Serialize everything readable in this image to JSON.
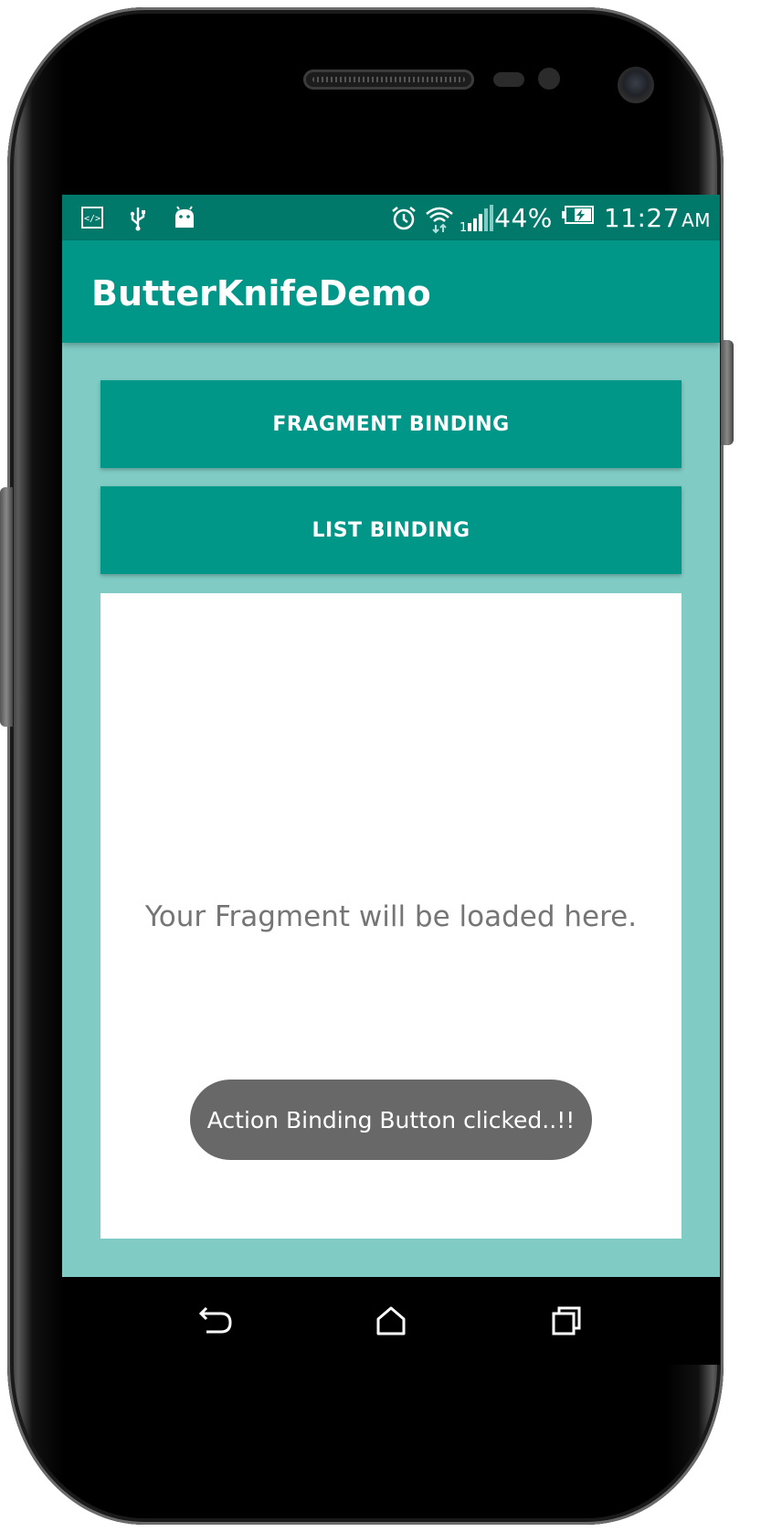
{
  "status_bar": {
    "icons_left": [
      "dev-code-icon",
      "usb-icon",
      "android-icon"
    ],
    "icons_right": [
      "alarm-icon",
      "wifi-icon",
      "signal-icon",
      "battery-icon"
    ],
    "battery_percent": "44%",
    "time": "11:27",
    "ampm": "AM"
  },
  "app_bar": {
    "title": "ButterKnifeDemo"
  },
  "buttons": {
    "fragment_binding": "FRAGMENT BINDING",
    "list_binding": "LIST BINDING"
  },
  "fragment": {
    "placeholder": "Your Fragment will be loaded here."
  },
  "toast": {
    "message": "Action Binding Button clicked..!!"
  },
  "colors": {
    "primary": "#009688",
    "primary_dark": "#00796b",
    "background": "#80cbc4",
    "toast": "#686868"
  }
}
